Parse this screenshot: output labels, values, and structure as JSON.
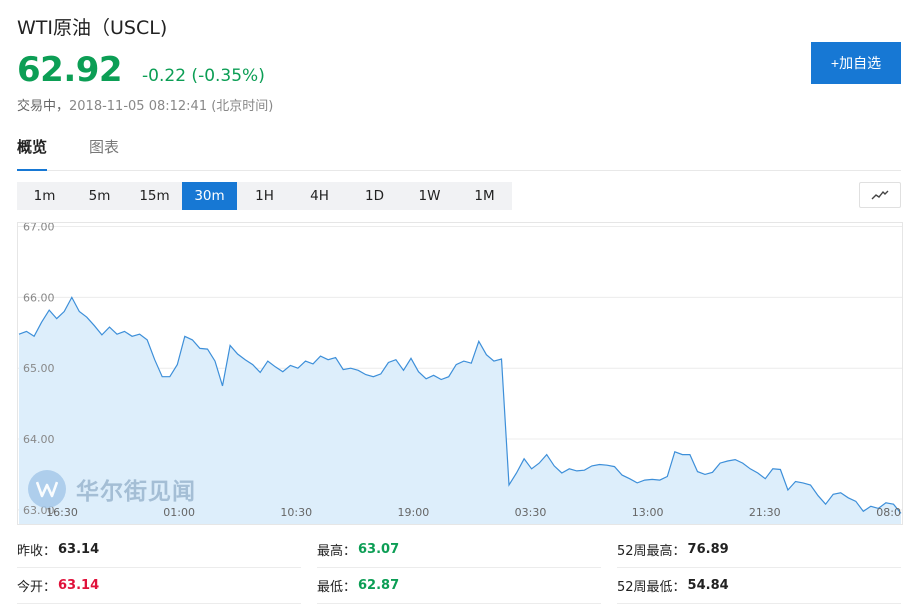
{
  "header": {
    "title": "WTI原油（USCL)",
    "price": "62.92",
    "change": "-0.22 (-0.35%)",
    "status_label": "交易中，",
    "timestamp": "2018-11-05 08:12:41 (北京时间)",
    "add_button": "+加自选"
  },
  "tabs": [
    {
      "label": "概览",
      "active": true
    },
    {
      "label": "图表",
      "active": false
    }
  ],
  "intervals": [
    {
      "label": "1m",
      "active": false
    },
    {
      "label": "5m",
      "active": false
    },
    {
      "label": "15m",
      "active": false
    },
    {
      "label": "30m",
      "active": true
    },
    {
      "label": "1H",
      "active": false
    },
    {
      "label": "4H",
      "active": false
    },
    {
      "label": "1D",
      "active": false
    },
    {
      "label": "1W",
      "active": false
    },
    {
      "label": "1M",
      "active": false
    }
  ],
  "chart_type_icon": "line-chart-icon",
  "watermark": {
    "text": "华尔街见闻",
    "logo_letter": "W"
  },
  "colors": {
    "accent": "#1778d4",
    "up": "#e0123b",
    "down": "#0c9e55",
    "line": "#3d8fd9",
    "area": "#ddeefb"
  },
  "chart_data": {
    "type": "area",
    "title": "",
    "xlabel": "",
    "ylabel": "",
    "ylim": [
      62.8,
      67.05
    ],
    "yticks": [
      "63.00",
      "64.00",
      "65.00",
      "66.00",
      "67.00"
    ],
    "xticks": [
      "16:30",
      "01:00",
      "10:30",
      "19:00",
      "03:30",
      "13:00",
      "21:30",
      "08:0"
    ],
    "grid": true,
    "series": [
      {
        "values": [
          65.48,
          65.52,
          65.45,
          65.65,
          65.82,
          65.7,
          65.8,
          66.0,
          65.8,
          65.72,
          65.6,
          65.47,
          65.58,
          65.48,
          65.52,
          65.45,
          65.48,
          65.4,
          65.12,
          64.88,
          64.88,
          65.05,
          65.45,
          65.4,
          65.28,
          65.27,
          65.1,
          64.75,
          65.32,
          65.2,
          65.12,
          65.05,
          64.94,
          65.1,
          65.02,
          64.95,
          65.04,
          65.0,
          65.1,
          65.06,
          65.17,
          65.12,
          65.15,
          64.98,
          65.0,
          64.97,
          64.91,
          64.88,
          64.92,
          65.08,
          65.12,
          64.97,
          65.14,
          64.95,
          64.85,
          64.9,
          64.84,
          64.88,
          65.05,
          65.1,
          65.07,
          65.38,
          65.19,
          65.1,
          65.13,
          63.35,
          63.52,
          63.72,
          63.58,
          63.66,
          63.78,
          63.62,
          63.52,
          63.58,
          63.55,
          63.56,
          63.62,
          63.64,
          63.63,
          63.61,
          63.49,
          63.44,
          63.38,
          63.42,
          63.43,
          63.42,
          63.47,
          63.82,
          63.78,
          63.78,
          63.54,
          63.5,
          63.53,
          63.66,
          63.69,
          63.71,
          63.66,
          63.58,
          63.52,
          63.44,
          63.58,
          63.57,
          63.28,
          63.4,
          63.38,
          63.35,
          63.2,
          63.08,
          63.22,
          63.24,
          63.17,
          63.12,
          62.98,
          63.05,
          63.02,
          63.1,
          63.08,
          62.95
        ]
      }
    ]
  },
  "stats": [
    {
      "label": "昨收：",
      "value": "63.14",
      "color": "neutral"
    },
    {
      "label": "最高：",
      "value": "63.07",
      "color": "green"
    },
    {
      "label": "52周最高：",
      "value": "76.89",
      "color": "neutral"
    },
    {
      "label": "今开：",
      "value": "63.14",
      "color": "red"
    },
    {
      "label": "最低：",
      "value": "62.87",
      "color": "green"
    },
    {
      "label": "52周最低：",
      "value": "54.84",
      "color": "neutral"
    }
  ]
}
